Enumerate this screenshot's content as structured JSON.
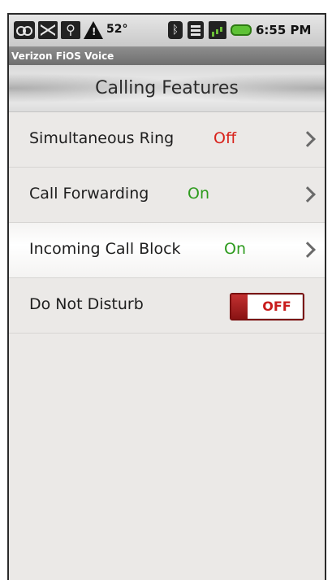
{
  "status_bar": {
    "temperature": "52°",
    "time": "6:55 PM",
    "icons": [
      "voicemail-icon",
      "mail-icon",
      "usb-icon",
      "warning-icon",
      "bluetooth-icon",
      "wifi-icon",
      "signal-icon",
      "battery-icon"
    ]
  },
  "app": {
    "title": "Verizon FiOS Voice"
  },
  "screen": {
    "title": "Calling Features"
  },
  "features": [
    {
      "label": "Simultaneous Ring",
      "status": "Off",
      "status_color": "#d8221b"
    },
    {
      "label": "Call Forwarding",
      "status": "On",
      "status_color": "#2e9b1e"
    },
    {
      "label": "Incoming Call Block",
      "status": "On",
      "status_color": "#2e9b1e"
    },
    {
      "label": "Do Not Disturb",
      "toggle_label": "OFF",
      "toggle_color": "#c81b1b"
    }
  ]
}
